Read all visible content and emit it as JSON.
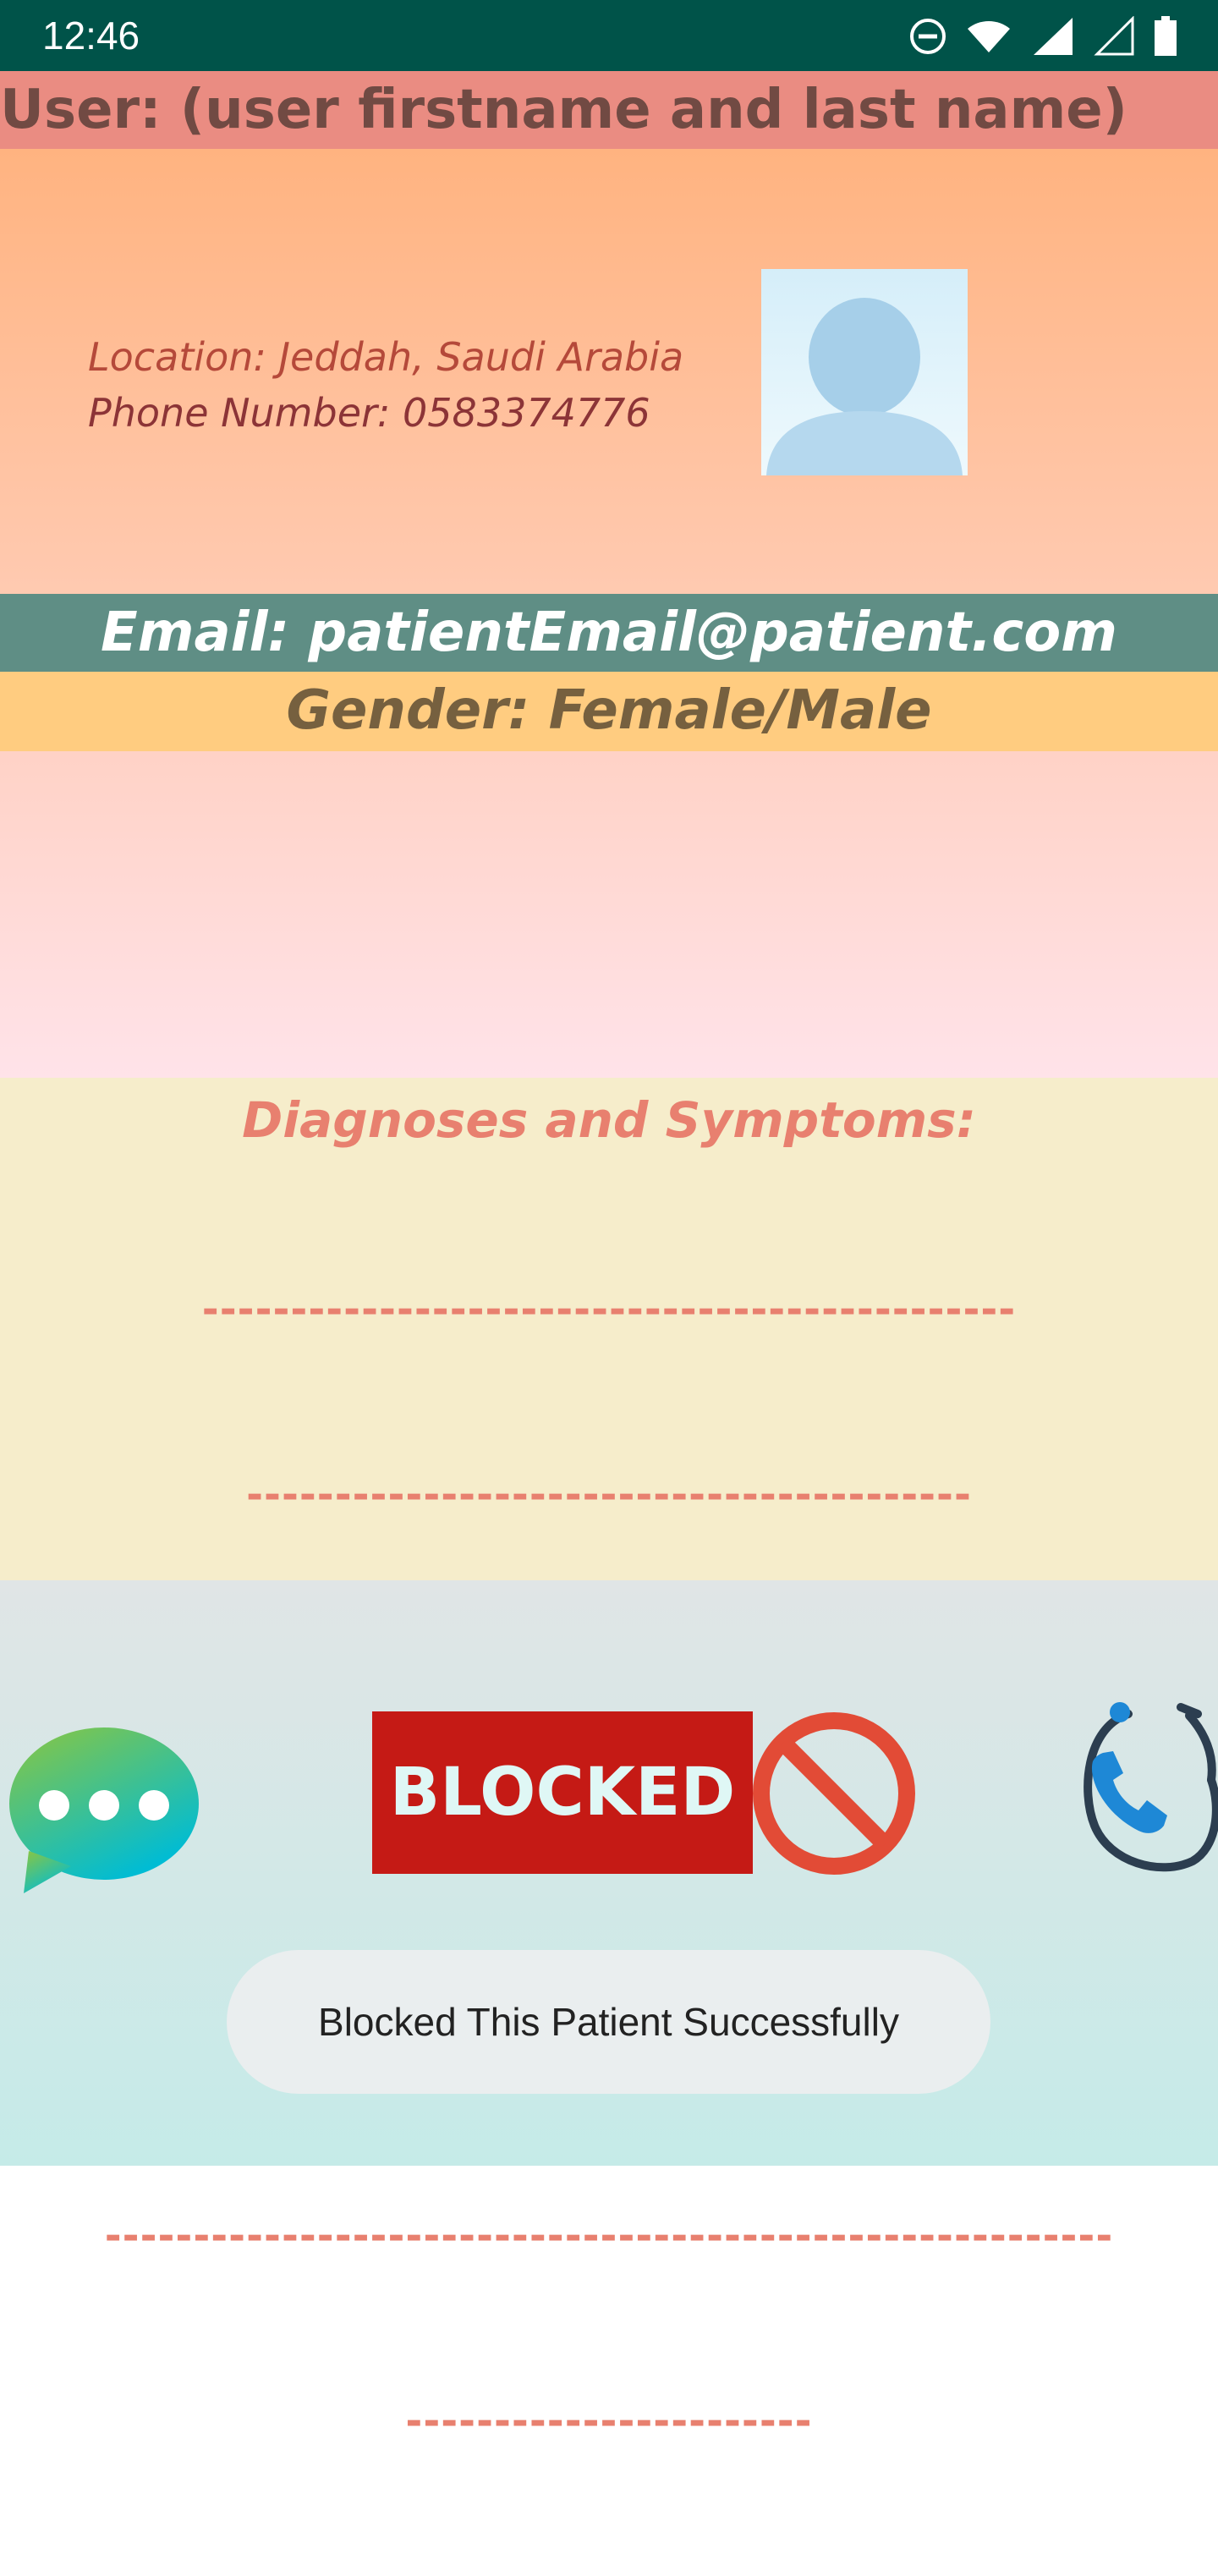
{
  "status_bar": {
    "time": "12:46",
    "icons": [
      "do-not-disturb-icon",
      "wifi-icon",
      "cell-signal-icon",
      "cell-signal-empty-icon",
      "battery-icon"
    ]
  },
  "header": {
    "user_label": "User: (user firstname and last name)"
  },
  "profile": {
    "location": "Location: Jeddah, Saudi Arabia",
    "phone": "Phone Number: 0583374776",
    "avatar_icon": "person-avatar-icon"
  },
  "email": "Email: patientEmail@patient.com",
  "gender": "Gender: Female/Male",
  "diagnoses": {
    "title": "Diagnoses and Symptoms:",
    "lines": [
      "----------------------------------------------",
      "-----------------------------------------",
      "---------------------------------------",
      "----------------------------------------",
      "----------------------------------------",
      "---------------------------------------------------------",
      "-----------------------"
    ]
  },
  "actions": {
    "chat_icon": "chat-bubble-icon",
    "blocked_label": "BLOCKED",
    "block_icon": "block-icon",
    "doctor_call_icon": "stethoscope-phone-icon"
  },
  "toast": {
    "message": "Blocked This Patient Successfully"
  },
  "colors": {
    "status_bar": "#005349",
    "header_bg": "#ea8c82",
    "email_bg": "#5f8e85",
    "gender_bg": "#ffcc80",
    "diagnoses_bg": "#f6edcb",
    "diagnoses_text": "#e8806f",
    "blocked_button": "#c51a15"
  }
}
